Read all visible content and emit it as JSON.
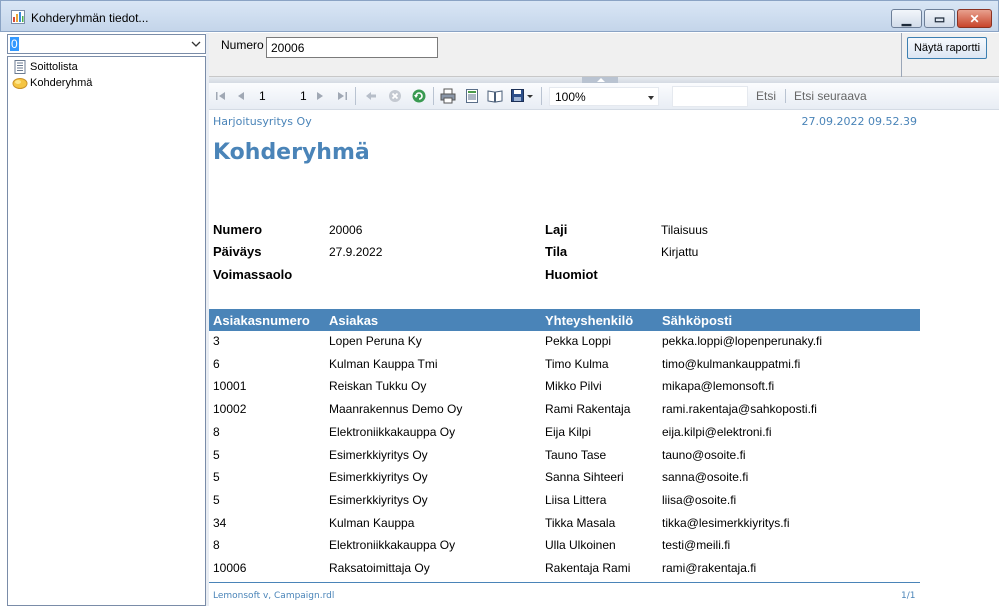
{
  "window": {
    "title": "Kohderyhmän tiedot...",
    "minimize_glyph": "▁",
    "maximize_glyph": "▭",
    "close_glyph": "✕"
  },
  "sidebar": {
    "combo_value": "0",
    "items": [
      {
        "label": "Soittolista",
        "icon": "document-list-icon"
      },
      {
        "label": "Kohderyhmä",
        "icon": "group-icon"
      }
    ]
  },
  "params": {
    "numero_label": "Numero",
    "numero_value": "20006",
    "run_button": "Näytä raportti"
  },
  "toolbar": {
    "current_page": "1",
    "total_pages": "1",
    "zoom": "100%",
    "find_label": "Etsi",
    "find_next_label": "Etsi seuraava"
  },
  "report": {
    "company": "Harjoitusyritys Oy",
    "datetime": "27.09.2022 09.52.39",
    "title": "Kohderyhmä",
    "fields": {
      "numero_label": "Numero",
      "numero_value": "20006",
      "paivays_label": "Päiväys",
      "paivays_value": "27.9.2022",
      "voimassaolo_label": "Voimassaolo",
      "laji_label": "Laji",
      "laji_value": "Tilaisuus",
      "tila_label": "Tila",
      "tila_value": "Kirjattu",
      "huomiot_label": "Huomiot"
    },
    "columns": [
      "Asiakasnumero",
      "Asiakas",
      "Yhteyshenkilö",
      "Sähköposti"
    ],
    "rows": [
      [
        "3",
        "Lopen Peruna Ky",
        "Pekka Loppi",
        "pekka.loppi@lopenperunaky.fi"
      ],
      [
        "6",
        "Kulman Kauppa Tmi",
        "Timo Kulma",
        "timo@kulmankauppatmi.fi"
      ],
      [
        "10001",
        "Reiskan Tukku Oy",
        "Mikko Pilvi",
        "mikapa@lemonsoft.fi"
      ],
      [
        "10002",
        "Maanrakennus Demo Oy",
        "Rami Rakentaja",
        "rami.rakentaja@sahkoposti.fi"
      ],
      [
        "8",
        "Elektroniikkakauppa Oy",
        "Eija Kilpi",
        "eija.kilpi@elektroni.fi"
      ],
      [
        "5",
        "Esimerkkiyritys Oy",
        "Tauno Tase",
        "tauno@osoite.fi"
      ],
      [
        "5",
        "Esimerkkiyritys Oy",
        "Sanna Sihteeri",
        "sanna@osoite.fi"
      ],
      [
        "5",
        "Esimerkkiyritys Oy",
        "Liisa Littera",
        "liisa@osoite.fi"
      ],
      [
        "34",
        "Kulman Kauppa",
        "Tikka Masala",
        "tikka@lesimerkkiyritys.fi"
      ],
      [
        "8",
        "Elektroniikkakauppa Oy",
        "Ulla Ulkoinen",
        "testi@meili.fi"
      ],
      [
        "10006",
        "Raksatoimittaja Oy",
        "Rakentaja Rami",
        "rami@rakentaja.fi"
      ]
    ],
    "footer_left": "Lemonsoft v, Campaign.rdl",
    "footer_right": "1/1"
  },
  "colors": {
    "accent": "#4a84b8",
    "selection": "#3399ff",
    "close_button": "#c8452b"
  }
}
